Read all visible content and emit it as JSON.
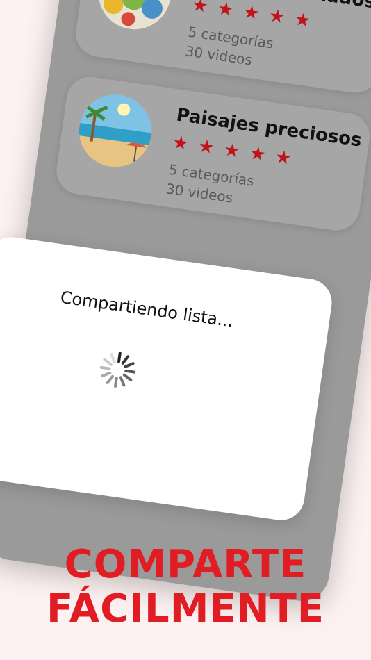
{
  "lists": [
    {
      "title": "Dibujos animados",
      "rating": 5,
      "categories": "5 categorías",
      "videos": "30 videos",
      "thumbnail": "bees-cartoon-image"
    },
    {
      "title": "Paisajes preciosos",
      "rating": 5,
      "categories": "5 categorías",
      "videos": "30 videos",
      "thumbnail": "beach-landscape-image"
    }
  ],
  "dialog": {
    "message": "Compartiendo lista...",
    "spinner": "loading-spinner-icon"
  },
  "headline": {
    "line1": "COMPARTE",
    "line2": "FÁCILMENTE"
  },
  "colors": {
    "accent": "#e11c22",
    "star": "#c0141a",
    "overlay": "#9a9a9a",
    "background": "#fdf2f2"
  }
}
